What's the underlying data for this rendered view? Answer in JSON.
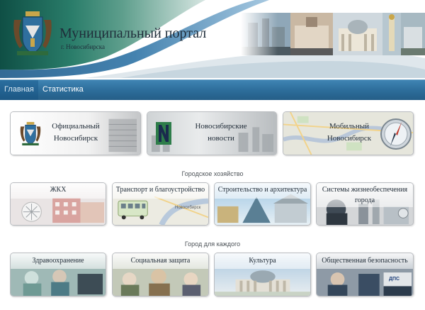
{
  "header": {
    "title": "Муниципальный портал",
    "city": "г. Новосибирска",
    "coat_icon": "coat-of-arms-icon",
    "photos": "city-panorama-photos"
  },
  "nav": {
    "items": [
      {
        "label": "Главная",
        "active": true
      },
      {
        "label": "Статистика",
        "active": false
      }
    ]
  },
  "top_tiles": [
    {
      "line1": "Официальный",
      "line2": "Новосибирск",
      "icon": "coat-of-arms-icon"
    },
    {
      "line1": "Новосибирские",
      "line2": "новости",
      "icon": "news-logo-icon"
    },
    {
      "line1": "Мобильный",
      "line2": "Новосибирск",
      "icon": "compass-icon"
    }
  ],
  "sections": [
    {
      "title": "Городское хозяйство",
      "tiles": [
        {
          "label": "ЖКХ"
        },
        {
          "label": "Транспорт и благоустройство",
          "map_label": "Новосибирск"
        },
        {
          "label": "Строительство и архитектура"
        },
        {
          "label": "Системы жизнеобеспечения",
          "label2": "города"
        }
      ]
    },
    {
      "title": "Город для каждого",
      "tiles": [
        {
          "label": "Здравоохранение"
        },
        {
          "label": "Социальная защита"
        },
        {
          "label": "Культура"
        },
        {
          "label": "Общественная безопасность",
          "badge": "ДПС"
        }
      ]
    }
  ],
  "colors": {
    "header_wave": "#2a7d6a",
    "nav_blue": "#2c6c99",
    "text_dark": "#1e2a36"
  }
}
